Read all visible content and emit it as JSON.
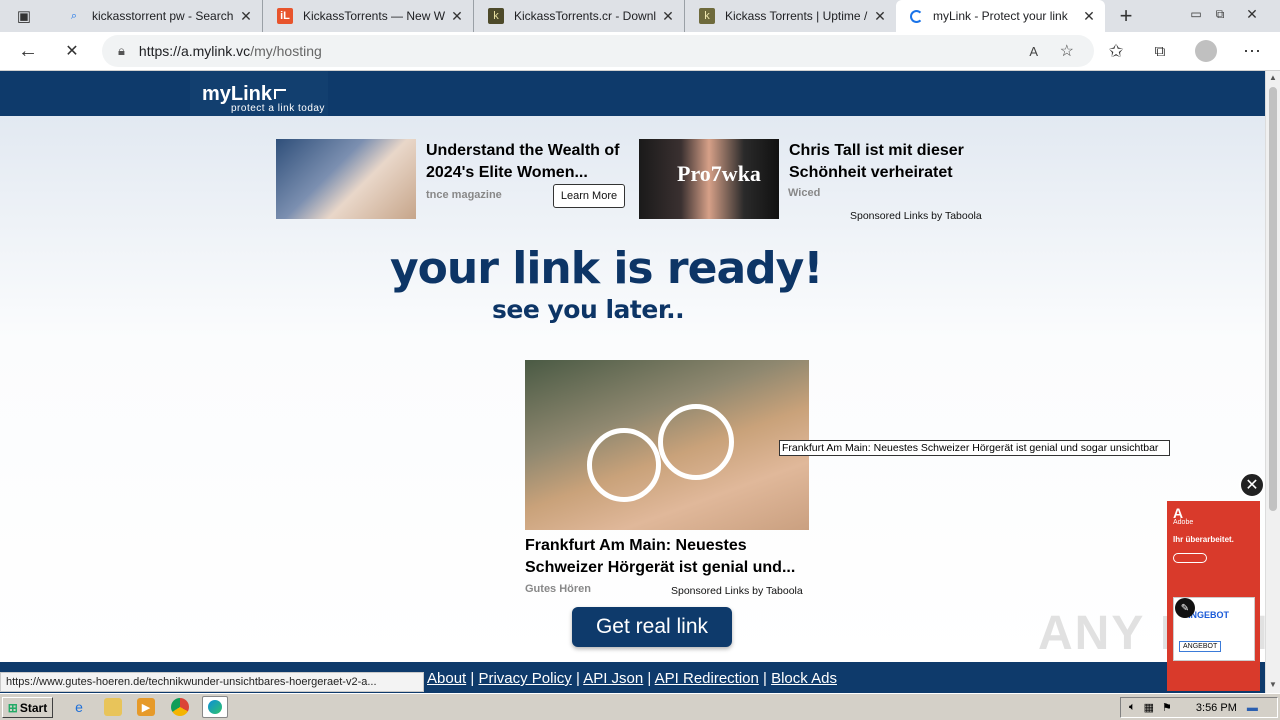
{
  "browser": {
    "tabs": [
      {
        "title": "kickasstorrent pw - Search",
        "icon": "search-icon"
      },
      {
        "title": "KickassTorrents — New W",
        "icon": "il-favicon-icon"
      },
      {
        "title": "KickassTorrents.cr - Downl",
        "icon": "kat-favicon-icon"
      },
      {
        "title": "Kickass Torrents | Uptime /",
        "icon": "kat-favicon-icon"
      },
      {
        "title": "myLink - Protect your link",
        "icon": "loading-icon",
        "active": true
      }
    ],
    "url_host": "https://a.mylink.vc",
    "url_path": "/my/hosting"
  },
  "page": {
    "logo_text": "myLink",
    "logo_tagline": "protect a link today",
    "ads_top": [
      {
        "title": "Understand the Wealth of 2024's Elite Women...",
        "source": "tnce magazine",
        "button": "Learn More"
      },
      {
        "title": "Chris Tall ist mit dieser Schönheit verheiratet",
        "source": "Wiced",
        "overlay_text": "Pro7wka"
      }
    ],
    "sponsored_label": "Sponsored Links by Taboola",
    "headline": "your link is ready!",
    "subheadline": "see you later..",
    "ad_main": {
      "title": "Frankfurt Am Main: Neuestes Schweizer Hörgerät ist genial und...",
      "source": "Gutes Hören",
      "sponsored": "Sponsored Links by Taboola"
    },
    "tooltip": "Frankfurt Am Main: Neuestes Schweizer Hörgerät ist genial und sogar unsichtbar",
    "get_link_button": "Get real link",
    "footer_links": [
      "About",
      "Privacy Policy",
      "API Json",
      "API Redirection",
      "Block Ads"
    ],
    "side_ad": {
      "brand": "Adobe",
      "line1": "Ihr überarbeitet.",
      "badge": "ANGEBOT",
      "badge2": "ANGEBOT"
    }
  },
  "status_url": "https://www.gutes-hoeren.de/technikwunder-unsichtbares-hoergeraet-v2-a...",
  "watermark": "ANY RUN",
  "taskbar": {
    "start_label": "Start",
    "clock": "3:56 PM"
  },
  "colors": {
    "brand_navy": "#0e3a6b",
    "headline": "#0d3566",
    "ad_red": "#d93a2b"
  }
}
